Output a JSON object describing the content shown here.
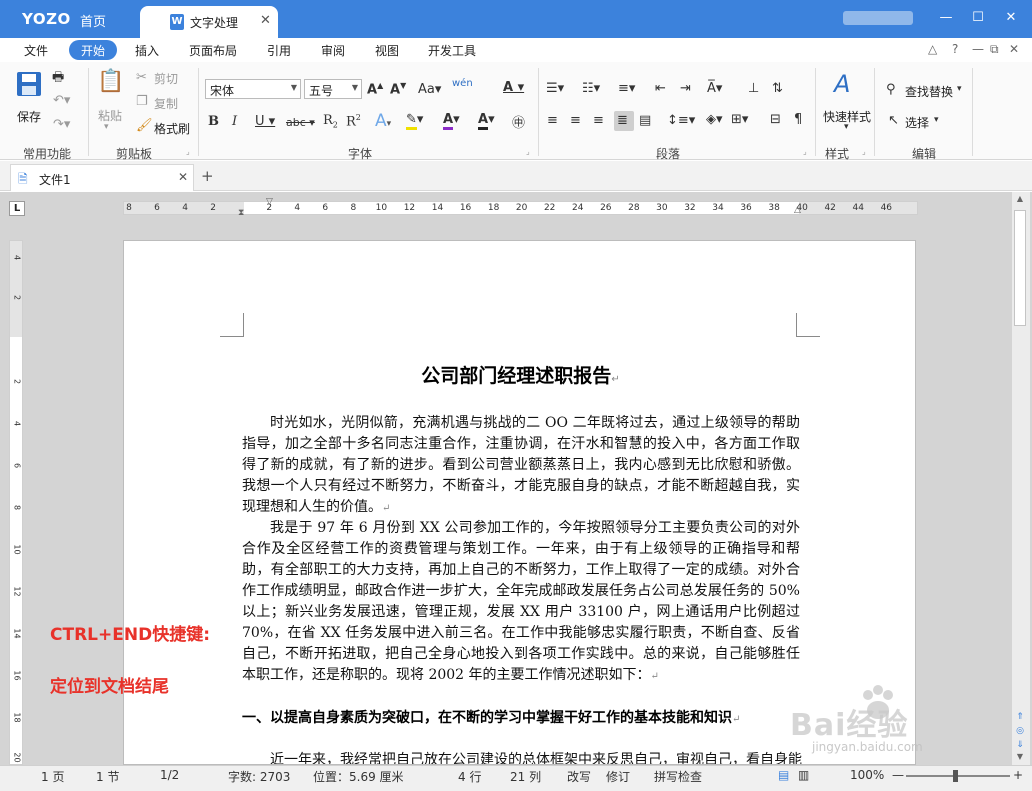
{
  "titlebar": {
    "logo": "YOZO",
    "home_tab": "首页",
    "doc_tab": {
      "icon_letter": "W",
      "label": "文字处理"
    },
    "controls": [
      "—",
      "☐",
      "✕"
    ]
  },
  "menubar": {
    "items": [
      "文件",
      "开始",
      "插入",
      "页面布局",
      "引用",
      "审阅",
      "视图",
      "开发工具"
    ],
    "active": "开始"
  },
  "ribbon": {
    "common": {
      "save": "保存",
      "group": "常用功能"
    },
    "clipboard": {
      "paste": "粘贴",
      "cut": "剪切",
      "copy": "复制",
      "format_painter": "格式刷",
      "group": "剪贴板"
    },
    "font": {
      "family": "宋体",
      "size": "五号",
      "group": "字体",
      "phonetic": "wén",
      "aa": "Aa"
    },
    "paragraph": {
      "group": "段落"
    },
    "styles": {
      "quick_styles": "快速样式",
      "group": "样式"
    },
    "edit": {
      "find_replace": "查找替换",
      "select": "选择",
      "group": "编辑"
    }
  },
  "tabs": {
    "file_tab": "文件1"
  },
  "ruler": {
    "h_ticks": [
      "8",
      "6",
      "4",
      "2",
      "2",
      "4",
      "6",
      "8",
      "10",
      "12",
      "14",
      "16",
      "18",
      "20",
      "22",
      "24",
      "26",
      "28",
      "30",
      "32",
      "34",
      "36",
      "38",
      "40",
      "42",
      "44",
      "46",
      "48"
    ],
    "v_ticks": [
      "4",
      "2",
      "2",
      "4",
      "6",
      "8",
      "10",
      "12",
      "14",
      "16",
      "18",
      "20"
    ],
    "corner": "L"
  },
  "document": {
    "title": "公司部门经理述职报告",
    "paragraphs": [
      "时光如水，光阴似箭，充满机遇与挑战的二 OO 二年既将过去，通过上级领导的帮助指导，加之全部十多名同志注重合作，注重协调，在汗水和智慧的投入中，各方面工作取得了新的成就，有了新的进步。看到公司营业额蒸蒸日上，我内心感到无比欣慰和骄傲。我想一个人只有经过不断努力，不断奋斗，才能克服自身的缺点，才能不断超越自我，实现理想和人生的价值。",
      "我是于 97 年 6 月份到 XX 公司参加工作的，今年按照领导分工主要负责公司的对外合作及全区经营工作的资费管理与策划工作。一年来，由于有上级领导的正确指导和帮助，有全部职工的大力支持，再加上自己的不断努力，工作上取得了一定的成绩。对外合作工作成绩明显，邮政合作进一步扩大，全年完成邮政发展任务占公司总发展任务的 50%以上；新兴业务发展迅速，管理正规，发展 XX 用户 33100 户，网上通话用户比例超过 70%，在省 XX 任务发展中进入前三名。在工作中我能够忠实履行职责，不断自查、反省自己，不断开拓进取，把自己全身心地投入到各项工作实践中。总的来说，自己能够胜任本职工作，还是称职的。现将 2002 年的主要工作情况述职如下："
    ],
    "heading1": "一、以提高自身素质为突破口，在不断的学习中掌握干好工作的基本技能和知识",
    "para3": "近一年来，我经常把自己放在公司建设的总体框架中来反思自己，审视自己，看自身能",
    "para_mark": "↵"
  },
  "annotation": {
    "line1": "CTRL+END快捷键:",
    "line2": "定位到文档结尾",
    "color": "#e8322a"
  },
  "watermark": {
    "main": "Bai经验",
    "sub": "jingyan.baidu.com"
  },
  "statusbar": {
    "page": "1 页",
    "section": "1 节",
    "page_of": "1/2",
    "word_count": "字数: 2703",
    "position": "位置：5.69 厘米",
    "row": "4 行",
    "col": "21 列",
    "overwrite": "改写",
    "revise": "修订",
    "spellcheck": "拼写检查",
    "zoom": "100%"
  },
  "colors": {
    "accent": "#3c82dc",
    "annotation": "#e8322a"
  }
}
